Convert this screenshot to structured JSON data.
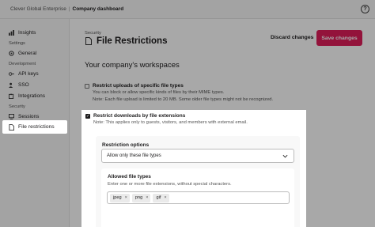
{
  "topbar": {
    "org": "Clever Global Enterprise",
    "separator": "|",
    "dashboard": "Company dashboard",
    "help_icon": "question-circle-icon",
    "help_label": "?"
  },
  "sidebar": {
    "items": [
      {
        "label": "Insights",
        "icon": "chart-icon"
      },
      {
        "label": "General",
        "icon": "gear-icon"
      },
      {
        "label": "API keys",
        "icon": "key-icon"
      },
      {
        "label": "SSO",
        "icon": "users-icon"
      },
      {
        "label": "Integrations",
        "icon": "puzzle-icon"
      },
      {
        "label": "Sessions",
        "icon": "monitor-icon"
      },
      {
        "label": "File restrictions",
        "icon": "file-icon"
      }
    ],
    "headers": [
      "Settings",
      "Development",
      "Security"
    ]
  },
  "main": {
    "breadcrumb": "Security",
    "title": "File Restrictions",
    "discard_label": "Discard changes",
    "save_label": "Save changes",
    "section_title": "Your company's workspaces",
    "option1": {
      "title": "Restrict uploads of specific file types",
      "desc1": "You can block or allow specific kinds of files by their MIME types.",
      "desc2": "Note: Each file upload is limited to 20 MB. Some older file types might not be recognized.",
      "checked": false
    },
    "option2": {
      "title": "Restrict downloads by file extensions",
      "desc": "Note: This applies only to guests, visitors, and members with external email.",
      "checked": true,
      "check_mark": "✓"
    },
    "restriction": {
      "label": "Restriction options",
      "selected": "Allow only these file types"
    },
    "allowed": {
      "label": "Allowed file types",
      "desc": "Enter one or more file extensions, without special characters.",
      "tags": [
        "jpeg",
        "png",
        "gif"
      ],
      "tag_remove": "×"
    }
  },
  "colors": {
    "accent": "#e01e5a",
    "sidebar_bg": "#f8f8f8",
    "overlay": "rgba(0,0,0,0.34)"
  }
}
